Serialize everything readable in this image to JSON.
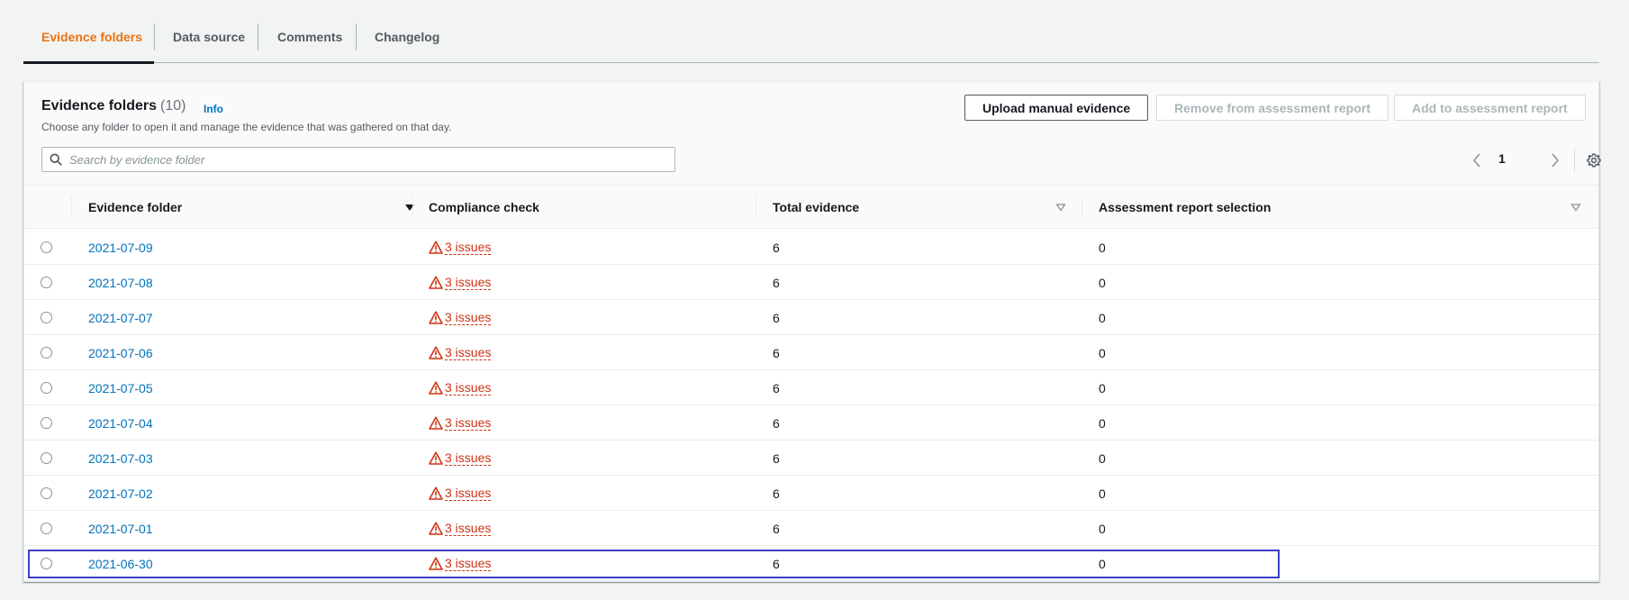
{
  "tabs": [
    {
      "label": "Evidence folders",
      "active": true
    },
    {
      "label": "Data source",
      "active": false
    },
    {
      "label": "Comments",
      "active": false
    },
    {
      "label": "Changelog",
      "active": false
    }
  ],
  "header": {
    "title": "Evidence folders",
    "count": "(10)",
    "info": "Info",
    "description": "Choose any folder to open it and manage the evidence that was gathered on that day."
  },
  "actions": {
    "upload": "Upload manual evidence",
    "remove": "Remove from assessment report",
    "add": "Add to assessment report"
  },
  "search": {
    "placeholder": "Search by evidence folder",
    "value": ""
  },
  "pagination": {
    "current_page": "1"
  },
  "columns": {
    "folder": "Evidence folder",
    "compliance": "Compliance check",
    "total": "Total evidence",
    "selection": "Assessment report selection"
  },
  "rows": [
    {
      "folder": "2021-07-09",
      "compliance": "3 issues",
      "total": "6",
      "selection": "0"
    },
    {
      "folder": "2021-07-08",
      "compliance": "3 issues",
      "total": "6",
      "selection": "0"
    },
    {
      "folder": "2021-07-07",
      "compliance": "3 issues",
      "total": "6",
      "selection": "0"
    },
    {
      "folder": "2021-07-06",
      "compliance": "3 issues",
      "total": "6",
      "selection": "0"
    },
    {
      "folder": "2021-07-05",
      "compliance": "3 issues",
      "total": "6",
      "selection": "0"
    },
    {
      "folder": "2021-07-04",
      "compliance": "3 issues",
      "total": "6",
      "selection": "0"
    },
    {
      "folder": "2021-07-03",
      "compliance": "3 issues",
      "total": "6",
      "selection": "0"
    },
    {
      "folder": "2021-07-02",
      "compliance": "3 issues",
      "total": "6",
      "selection": "0"
    },
    {
      "folder": "2021-07-01",
      "compliance": "3 issues",
      "total": "6",
      "selection": "0"
    },
    {
      "folder": "2021-06-30",
      "compliance": "3 issues",
      "total": "6",
      "selection": "0"
    }
  ],
  "colors": {
    "accent_tab": "#ec7211",
    "link": "#0073bb",
    "warning": "#d13212",
    "focus": "#3b3fc2"
  },
  "icons": {
    "search": "search-icon",
    "warning": "warning-icon",
    "prev": "chevron-left-icon",
    "next": "chevron-right-icon",
    "settings": "gear-icon",
    "sort_active": "caret-down-filled-icon",
    "sort": "caret-down-outline-icon"
  }
}
